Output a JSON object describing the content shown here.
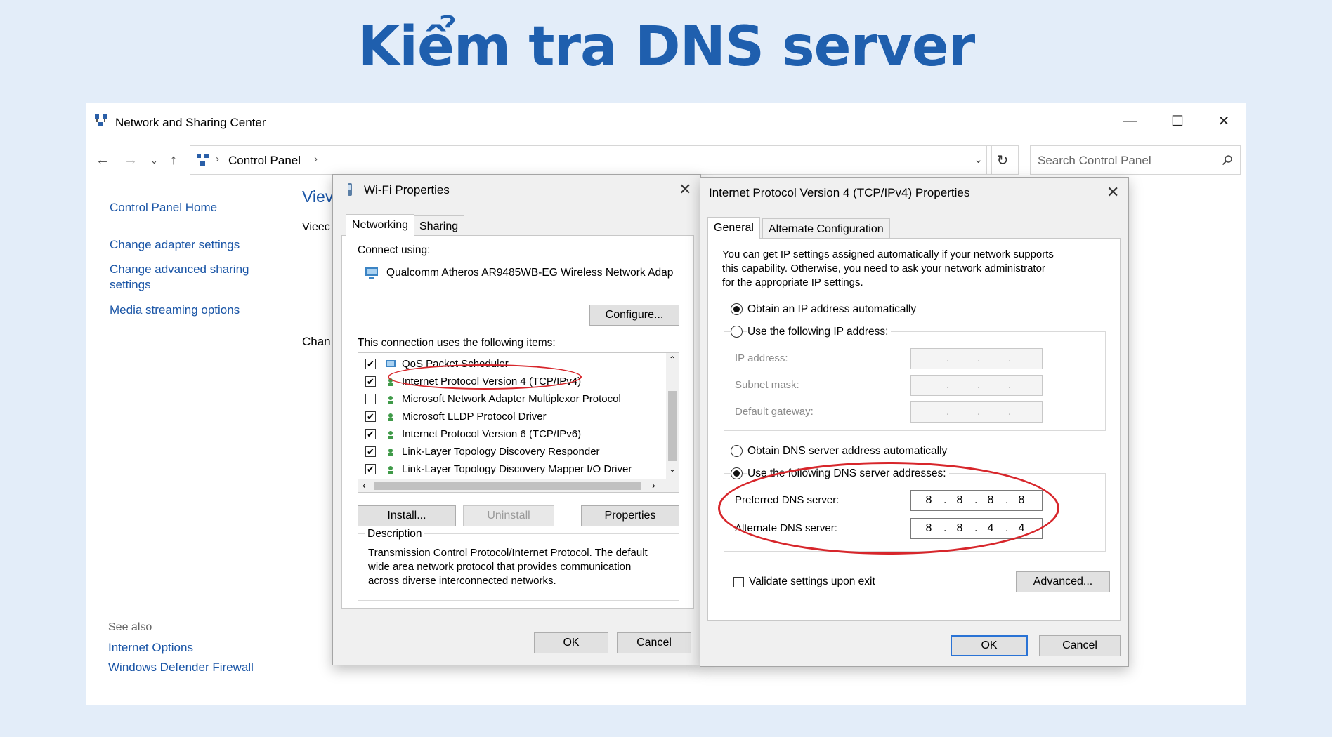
{
  "headline": "Kiểm tra DNS server",
  "window": {
    "title": "Network and Sharing Center",
    "minimize": "—",
    "maximize": "☐",
    "close": "✕",
    "breadcrumb": "Control Panel",
    "search_placeholder": "Search Control Panel",
    "sidebar": [
      "Control Panel Home",
      "Change adapter settings",
      "Change advanced sharing",
      "settings",
      "Media streaming options"
    ],
    "see_also": "See also",
    "see_also_links": [
      "Internet Options",
      "Windows Defender Firewall"
    ],
    "main_peek": [
      "Viev",
      "Vieec",
      "Chan"
    ]
  },
  "wifi": {
    "title": "Wi-Fi Properties",
    "tabs": [
      "Networking",
      "Sharing"
    ],
    "connect_using": "Connect using:",
    "adapter": "Qualcomm Atheros AR9485WB-EG Wireless Network Adap",
    "configure": "Configure...",
    "items_label": "This connection uses the following items:",
    "items": [
      {
        "label": "QoS Packet Scheduler",
        "checked": true
      },
      {
        "label": "Internet Protocol Version 4 (TCP/IPv4)",
        "checked": true
      },
      {
        "label": "Microsoft Network Adapter Multiplexor Protocol",
        "checked": false
      },
      {
        "label": "Microsoft LLDP Protocol Driver",
        "checked": true
      },
      {
        "label": "Internet Protocol Version 6 (TCP/IPv6)",
        "checked": true
      },
      {
        "label": "Link-Layer Topology Discovery Responder",
        "checked": true
      },
      {
        "label": "Link-Layer Topology Discovery Mapper I/O Driver",
        "checked": true
      }
    ],
    "install": "Install...",
    "uninstall": "Uninstall",
    "properties": "Properties",
    "description_title": "Description",
    "description": [
      "Transmission Control Protocol/Internet Protocol. The default",
      "wide area network protocol that provides communication",
      "across diverse interconnected networks."
    ],
    "ok": "OK",
    "cancel": "Cancel"
  },
  "ipv4": {
    "title": "Internet Protocol Version 4 (TCP/IPv4) Properties",
    "tabs": [
      "General",
      "Alternate Configuration"
    ],
    "intro": [
      "You can get IP settings assigned automatically if your network supports",
      "this capability. Otherwise, you need to ask your network administrator",
      "for the appropriate IP settings."
    ],
    "obtain_ip": "Obtain an IP address automatically",
    "use_ip": "Use the following IP address:",
    "ip_address": "IP address:",
    "subnet_mask": "Subnet mask:",
    "default_gateway": "Default gateway:",
    "obtain_dns": "Obtain DNS server address automatically",
    "use_dns": "Use the following DNS server addresses:",
    "preferred_dns_label": "Preferred DNS server:",
    "preferred_dns": [
      "8",
      "8",
      "8",
      "8"
    ],
    "alternate_dns_label": "Alternate DNS server:",
    "alternate_dns": [
      "8",
      "8",
      "4",
      "4"
    ],
    "validate": "Validate settings upon exit",
    "advanced": "Advanced...",
    "ok": "OK",
    "cancel": "Cancel"
  },
  "colors": {
    "headline": "#1f5fae",
    "link": "#1a55a6",
    "highlight": "#d7262b"
  }
}
